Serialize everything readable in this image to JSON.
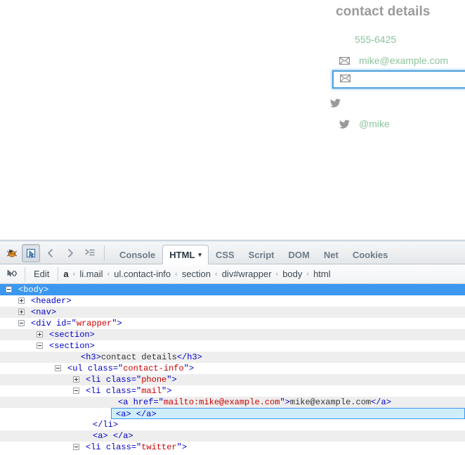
{
  "page": {
    "heading": "contact details",
    "contacts": [
      {
        "icon": "",
        "icon_name": "none",
        "text": "555-6425",
        "class": "phone"
      },
      {
        "icon": "✉",
        "icon_name": "envelope-icon",
        "text": "mike@example.com",
        "class": "mail"
      },
      {
        "icon": "✉",
        "icon_name": "envelope-icon",
        "text": "",
        "class": "mail-empty"
      },
      {
        "icon": "twitter",
        "icon_name": "twitter-icon",
        "text": "",
        "class": "twitter-empty"
      },
      {
        "icon": "twitter",
        "icon_name": "twitter-icon",
        "text": "@mike",
        "class": "twitter"
      }
    ],
    "colors": {
      "heading": "#9b9b9b",
      "link": "#8ec49c",
      "icon": "#9a9a9a",
      "inspect_border": "#4ea2e0"
    }
  },
  "firebug": {
    "toolbar": {
      "logo": "firebug-bug-icon",
      "inspect_label": "inspect-element-icon",
      "back_label": "‹",
      "forward_label": "›",
      "quickinfo_label": "quick-info-icon",
      "tabs": [
        {
          "label": "Console",
          "selected": false
        },
        {
          "label": "HTML",
          "selected": true,
          "caret": "▾"
        },
        {
          "label": "CSS",
          "selected": false
        },
        {
          "label": "Script",
          "selected": false
        },
        {
          "label": "DOM",
          "selected": false
        },
        {
          "label": "Net",
          "selected": false
        },
        {
          "label": "Cookies",
          "selected": false
        }
      ]
    },
    "breadcrumb": {
      "inspect_icon": "inspect-code-icon",
      "edit_label": "Edit",
      "separator": "‹",
      "trail": [
        {
          "label": "a",
          "current": true
        },
        {
          "label": "li.mail",
          "current": false
        },
        {
          "label": "ul.contact-info",
          "current": false
        },
        {
          "label": "section",
          "current": false
        },
        {
          "label": "div#wrapper",
          "current": false
        },
        {
          "label": "body",
          "current": false
        },
        {
          "label": "html",
          "current": false
        }
      ]
    },
    "tree": [
      {
        "indent": 26,
        "twisty": "open",
        "stripe": "selected",
        "selected": true,
        "tokens": [
          {
            "t": "punct",
            "v": "<"
          },
          {
            "t": "tag",
            "v": "body"
          },
          {
            "t": "punct",
            "v": ">"
          }
        ]
      },
      {
        "indent": 44,
        "twisty": "closed",
        "stripe": "odd",
        "tokens": [
          {
            "t": "punct",
            "v": "<"
          },
          {
            "t": "tag",
            "v": "header"
          },
          {
            "t": "punct",
            "v": ">"
          }
        ]
      },
      {
        "indent": 44,
        "twisty": "closed",
        "stripe": "even",
        "tokens": [
          {
            "t": "punct",
            "v": "<"
          },
          {
            "t": "tag",
            "v": "nav"
          },
          {
            "t": "punct",
            "v": ">"
          }
        ]
      },
      {
        "indent": 44,
        "twisty": "open",
        "stripe": "odd",
        "tokens": [
          {
            "t": "punct",
            "v": "<"
          },
          {
            "t": "tag",
            "v": "div"
          },
          {
            "t": "text",
            "v": " "
          },
          {
            "t": "attr",
            "v": "id"
          },
          {
            "t": "punct",
            "v": "="
          },
          {
            "t": "punct",
            "v": "\""
          },
          {
            "t": "val",
            "v": "wrapper"
          },
          {
            "t": "punct",
            "v": "\""
          },
          {
            "t": "punct",
            "v": ">"
          }
        ]
      },
      {
        "indent": 70,
        "twisty": "closed",
        "stripe": "even",
        "tokens": [
          {
            "t": "punct",
            "v": "<"
          },
          {
            "t": "tag",
            "v": "section"
          },
          {
            "t": "punct",
            "v": ">"
          }
        ]
      },
      {
        "indent": 70,
        "twisty": "open",
        "stripe": "odd",
        "tokens": [
          {
            "t": "punct",
            "v": "<"
          },
          {
            "t": "tag",
            "v": "section"
          },
          {
            "t": "punct",
            "v": ">"
          }
        ]
      },
      {
        "indent": 115,
        "twisty": "none",
        "stripe": "even",
        "tokens": [
          {
            "t": "punct",
            "v": "<"
          },
          {
            "t": "tag",
            "v": "h3"
          },
          {
            "t": "punct",
            "v": ">"
          },
          {
            "t": "text",
            "v": "contact details"
          },
          {
            "t": "punct",
            "v": "</"
          },
          {
            "t": "tag",
            "v": "h3"
          },
          {
            "t": "punct",
            "v": ">"
          }
        ]
      },
      {
        "indent": 96,
        "twisty": "open",
        "stripe": "odd",
        "tokens": [
          {
            "t": "punct",
            "v": "<"
          },
          {
            "t": "tag",
            "v": "ul"
          },
          {
            "t": "text",
            "v": " "
          },
          {
            "t": "attr",
            "v": "class"
          },
          {
            "t": "punct",
            "v": "="
          },
          {
            "t": "punct",
            "v": "\""
          },
          {
            "t": "val",
            "v": "contact-info"
          },
          {
            "t": "punct",
            "v": "\""
          },
          {
            "t": "punct",
            "v": ">"
          }
        ]
      },
      {
        "indent": 122,
        "twisty": "closed",
        "stripe": "even",
        "tokens": [
          {
            "t": "punct",
            "v": "<"
          },
          {
            "t": "tag",
            "v": "li"
          },
          {
            "t": "text",
            "v": " "
          },
          {
            "t": "attr",
            "v": "class"
          },
          {
            "t": "punct",
            "v": "="
          },
          {
            "t": "punct",
            "v": "\""
          },
          {
            "t": "val",
            "v": "phone"
          },
          {
            "t": "punct",
            "v": "\""
          },
          {
            "t": "punct",
            "v": ">"
          }
        ]
      },
      {
        "indent": 122,
        "twisty": "open",
        "stripe": "odd",
        "tokens": [
          {
            "t": "punct",
            "v": "<"
          },
          {
            "t": "tag",
            "v": "li"
          },
          {
            "t": "text",
            "v": " "
          },
          {
            "t": "attr",
            "v": "class"
          },
          {
            "t": "punct",
            "v": "="
          },
          {
            "t": "punct",
            "v": "\""
          },
          {
            "t": "val",
            "v": "mail"
          },
          {
            "t": "punct",
            "v": "\""
          },
          {
            "t": "punct",
            "v": ">"
          }
        ]
      },
      {
        "indent": 168,
        "twisty": "none",
        "stripe": "even",
        "tokens": [
          {
            "t": "punct",
            "v": "<"
          },
          {
            "t": "tag",
            "v": "a"
          },
          {
            "t": "text",
            "v": " "
          },
          {
            "t": "attr",
            "v": "href"
          },
          {
            "t": "punct",
            "v": "="
          },
          {
            "t": "punct",
            "v": "\""
          },
          {
            "t": "val",
            "v": "mailto:mike@example.com"
          },
          {
            "t": "punct",
            "v": "\""
          },
          {
            "t": "punct",
            "v": ">"
          },
          {
            "t": "text",
            "v": "mike@example.com"
          },
          {
            "t": "punct",
            "v": "</"
          },
          {
            "t": "tag",
            "v": "a"
          },
          {
            "t": "punct",
            "v": ">"
          }
        ]
      },
      {
        "indent": 164,
        "twisty": "none",
        "stripe": "inspected",
        "inspected": true,
        "tokens": [
          {
            "t": "punct",
            "v": "<"
          },
          {
            "t": "tag",
            "v": "a"
          },
          {
            "t": "punct",
            "v": ">"
          },
          {
            "t": "text",
            "v": " "
          },
          {
            "t": "punct",
            "v": "</"
          },
          {
            "t": "tag",
            "v": "a"
          },
          {
            "t": "punct",
            "v": ">"
          }
        ]
      },
      {
        "indent": 132,
        "twisty": "none",
        "stripe": "odd",
        "tokens": [
          {
            "t": "punct",
            "v": "</"
          },
          {
            "t": "tag",
            "v": "li"
          },
          {
            "t": "punct",
            "v": ">"
          }
        ]
      },
      {
        "indent": 132,
        "twisty": "none",
        "stripe": "even",
        "tokens": [
          {
            "t": "punct",
            "v": "<"
          },
          {
            "t": "tag",
            "v": "a"
          },
          {
            "t": "punct",
            "v": ">"
          },
          {
            "t": "text",
            "v": "  "
          },
          {
            "t": "punct",
            "v": "</"
          },
          {
            "t": "tag",
            "v": "a"
          },
          {
            "t": "punct",
            "v": ">"
          }
        ]
      },
      {
        "indent": 122,
        "twisty": "open",
        "stripe": "odd",
        "tokens": [
          {
            "t": "punct",
            "v": "<"
          },
          {
            "t": "tag",
            "v": "li"
          },
          {
            "t": "text",
            "v": " "
          },
          {
            "t": "attr",
            "v": "class"
          },
          {
            "t": "punct",
            "v": "="
          },
          {
            "t": "punct",
            "v": "\""
          },
          {
            "t": "val",
            "v": "twitter"
          },
          {
            "t": "punct",
            "v": "\""
          },
          {
            "t": "punct",
            "v": ">"
          }
        ]
      }
    ]
  }
}
